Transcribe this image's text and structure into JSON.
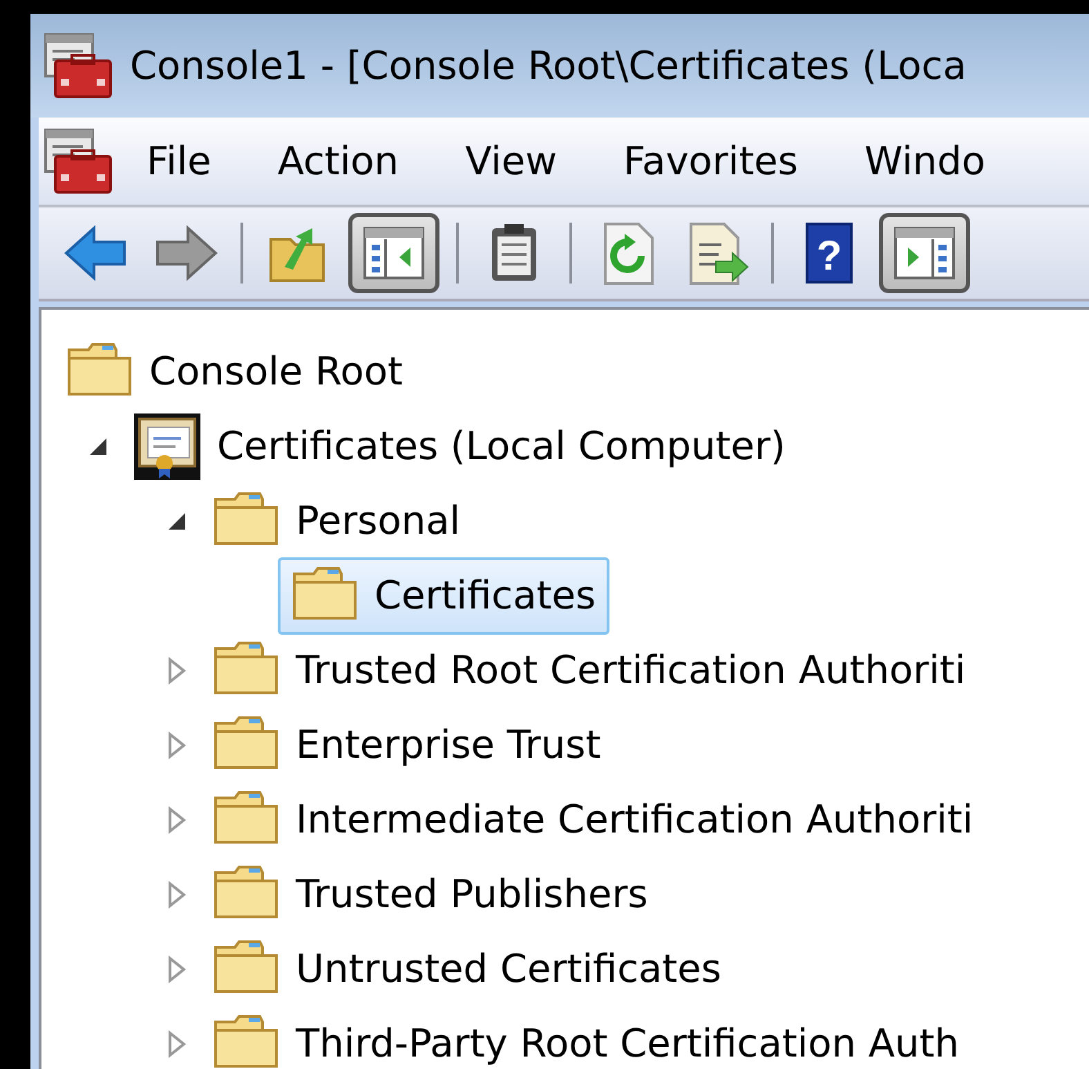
{
  "window": {
    "title": "Console1 - [Console Root\\Certificates (Loca"
  },
  "menu": [
    {
      "label": "File"
    },
    {
      "label": "Action"
    },
    {
      "label": "View"
    },
    {
      "label": "Favorites"
    },
    {
      "label": "Windo"
    }
  ],
  "toolbar": [
    {
      "kind": "back",
      "disabled": false
    },
    {
      "kind": "forward",
      "disabled": true
    },
    {
      "kind": "separator"
    },
    {
      "kind": "up"
    },
    {
      "kind": "tree-pane",
      "pressed": true
    },
    {
      "kind": "separator"
    },
    {
      "kind": "clipboard"
    },
    {
      "kind": "separator"
    },
    {
      "kind": "refresh"
    },
    {
      "kind": "export"
    },
    {
      "kind": "separator"
    },
    {
      "kind": "help",
      "label": "?"
    },
    {
      "kind": "action-pane",
      "pressed": true
    }
  ],
  "tree": {
    "label": "Console Root",
    "children": [
      {
        "label": "Certificates (Local Computer)",
        "kind": "snapin",
        "expanded": true,
        "selected": false,
        "children": [
          {
            "label": "Personal",
            "expanded": true,
            "selected": false,
            "children": [
              {
                "label": "Certificates",
                "selected": true
              }
            ]
          },
          {
            "label": "Trusted Root Certification Authoriti",
            "expanded": false,
            "selected": false
          },
          {
            "label": "Enterprise Trust",
            "expanded": false,
            "selected": false
          },
          {
            "label": "Intermediate Certification Authoriti",
            "expanded": false,
            "selected": false
          },
          {
            "label": "Trusted Publishers",
            "expanded": false,
            "selected": false
          },
          {
            "label": "Untrusted Certificates",
            "expanded": false,
            "selected": false
          },
          {
            "label": "Third-Party Root Certification Auth",
            "expanded": false,
            "selected": false
          }
        ]
      }
    ]
  }
}
